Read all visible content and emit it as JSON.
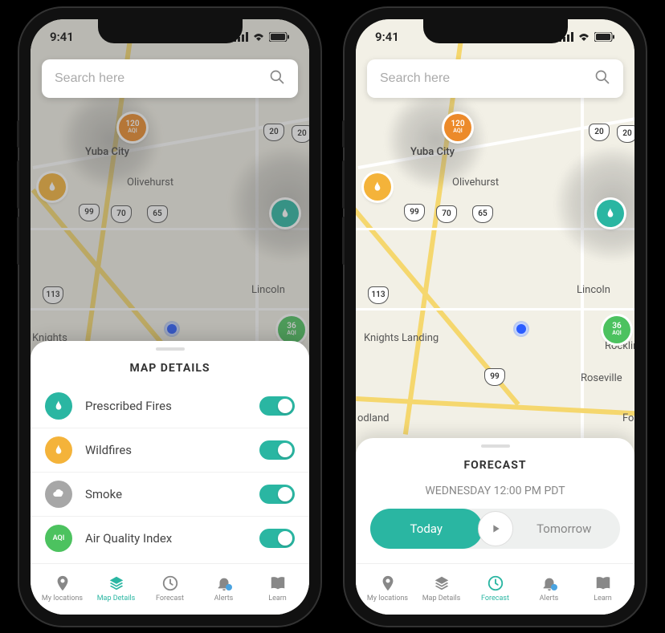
{
  "status": {
    "time": "9:41"
  },
  "search": {
    "placeholder": "Search here"
  },
  "map": {
    "cities": {
      "yuba": "Yuba City",
      "olivehurst": "Olivehurst",
      "lincoln": "Lincoln",
      "knights": "Knights",
      "knights_landing": "Knights Landing",
      "roseville": "Roseville",
      "rocklin": "Rocklin",
      "odland": "odland",
      "fo": "Fo"
    },
    "highways": {
      "h99a": "99",
      "h99b": "99",
      "h70": "70",
      "h65": "65",
      "h113": "113",
      "h20a": "20",
      "h20b": "20"
    },
    "aqi_orange": {
      "value": "120",
      "sub": "AQI"
    },
    "aqi_green": {
      "value": "36",
      "sub": "AQI"
    }
  },
  "sheet_details": {
    "title": "MAP DETAILS",
    "rows": [
      {
        "label": "Prescribed Fires"
      },
      {
        "label": "Wildfires"
      },
      {
        "label": "Smoke"
      },
      {
        "label": "Air Quality Index"
      }
    ],
    "aqi_icon_text": "AQI"
  },
  "sheet_forecast": {
    "title": "FORECAST",
    "subtitle": "WEDNESDAY 12:00 PM PDT",
    "today": "Today",
    "tomorrow": "Tomorrow"
  },
  "tabs": {
    "my_locations": "My locations",
    "map_details": "Map Details",
    "forecast": "Forecast",
    "alerts": "Alerts",
    "learn": "Learn"
  }
}
